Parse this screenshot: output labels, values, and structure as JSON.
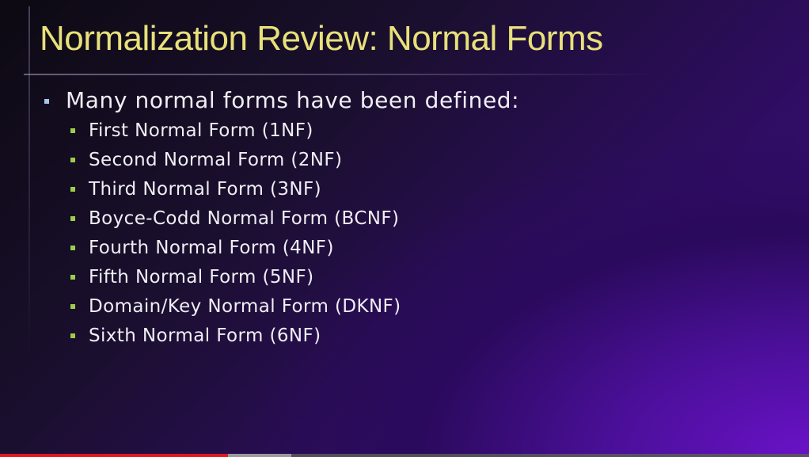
{
  "slide": {
    "title": "Normalization Review: Normal Forms",
    "intro": "Many normal forms have been defined:",
    "items": [
      {
        "label": "First Normal Form (1NF)"
      },
      {
        "label": "Second Normal Form (2NF)"
      },
      {
        "label": "Third Normal Form (3NF)"
      },
      {
        "label": "Boyce-Codd Normal Form (BCNF)"
      },
      {
        "label": "Fourth Normal Form (4NF)"
      },
      {
        "label": "Fifth Normal Form (5NF)"
      },
      {
        "label": "Domain/Key Normal Form (DKNF)"
      },
      {
        "label": "Sixth Normal Form (6NF)"
      }
    ]
  },
  "player": {
    "played_fraction": 0.282,
    "buffered_fraction": 0.36
  },
  "colors": {
    "title": "#e8e07a",
    "text": "#f0eef4",
    "level1_bullet": "#a8c4e6",
    "level2_bullet": "#9ccd4a",
    "progress_played": "#e1161e",
    "progress_buffered": "#9a9a9a"
  }
}
